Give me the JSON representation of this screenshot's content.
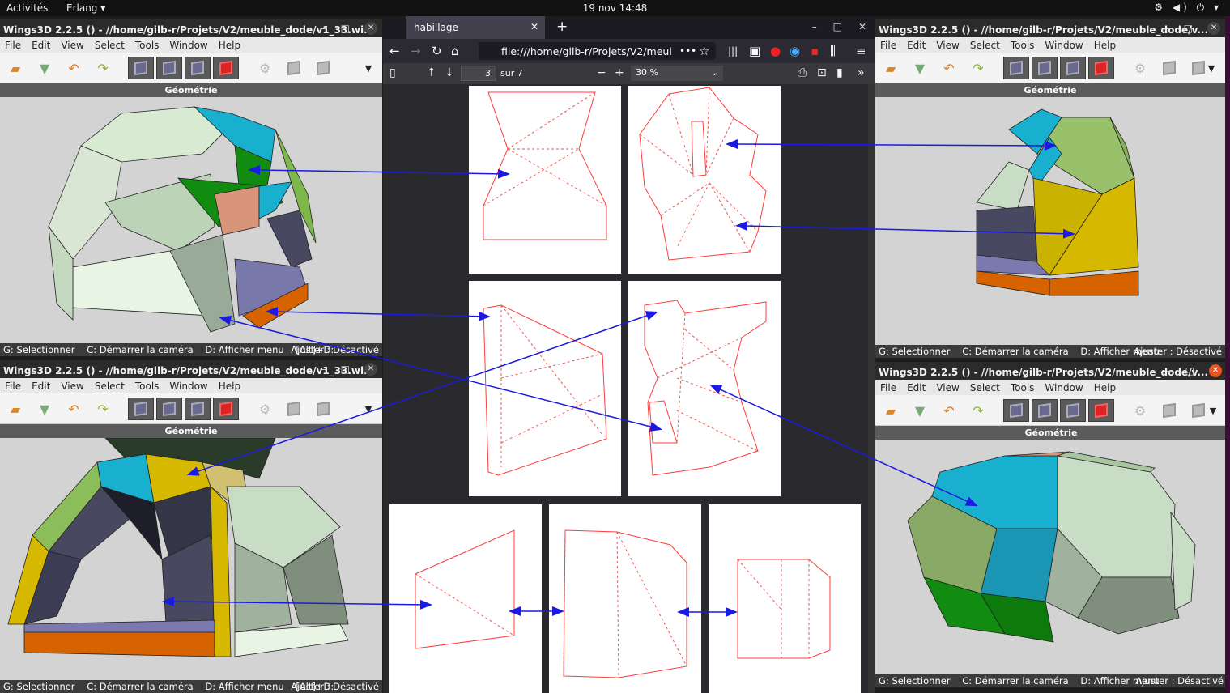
{
  "topbar": {
    "activities": "Activités",
    "app": "Erlang ▾",
    "clock": "19 nov  14:48",
    "tray": "⚙ ◀) ⏻ ▾"
  },
  "menus": [
    "File",
    "Edit",
    "View",
    "Select",
    "Tools",
    "Window",
    "Help"
  ],
  "panel_label": "Géométrie",
  "windows": {
    "tl": {
      "title": "Wings3D 2.2.5 () - //home/gilb-r/Projets/V2/meuble_dode/v1_33.wi..."
    },
    "bl": {
      "title": "Wings3D 2.2.5 () - //home/gilb-r/Projets/V2/meuble_dode/v1_33.wi..."
    },
    "tr": {
      "title": "Wings3D 2.2.5 () - //home/gilb-r/Projets/V2/meuble_dode/v..."
    },
    "br": {
      "title": "Wings3D 2.2.5 () - //home/gilb-r/Projets/V2/meuble_dode/v..."
    }
  },
  "status": {
    "select": "G: Selectionner",
    "camera": "C: Démarrer la caméra",
    "menu": "D: Afficher menu",
    "alt": "[Alt]+D:",
    "adjust": "Ajuster : Désactivé"
  },
  "firefox": {
    "tab": "habillage",
    "url": "file:///home/gilb-r/Projets/V2/meul",
    "page": "3",
    "page_of": "sur 7",
    "zoom": "30 %",
    "more": "•••"
  },
  "colors": {
    "face_light": "#d9ead3",
    "face_cyan": "#19b0d0",
    "face_green": "#118c11",
    "face_salmon": "#d9957a",
    "face_navy": "#484860",
    "face_yellow": "#d6b800",
    "face_orange": "#d76200",
    "arrow": "#1a1ae0",
    "pattern_line": "#ff3b3b"
  }
}
